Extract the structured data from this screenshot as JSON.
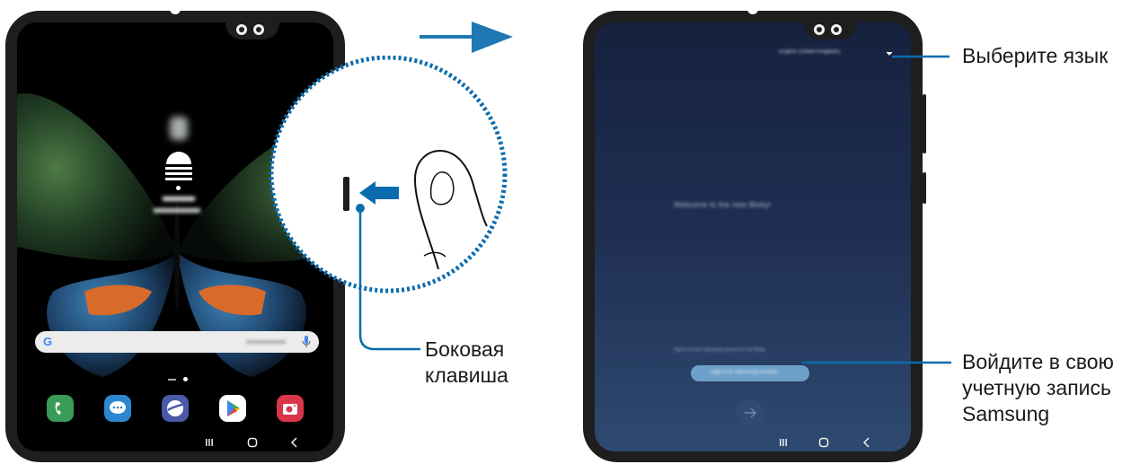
{
  "callouts": {
    "side_key_line1": "Боковая",
    "side_key_line2": "клавиша",
    "select_language": "Выберите язык",
    "sign_in_line1": "Войдите в свою",
    "sign_in_line2": "учетную запись",
    "sign_in_line3": "Samsung"
  },
  "left_device": {
    "search_bar_google_letter": "G",
    "nav_icons": [
      "recent-apps-icon",
      "home-icon",
      "back-icon"
    ],
    "dock_apps": [
      "phone-app-icon",
      "messages-app-icon",
      "internet-app-icon",
      "play-store-app-icon",
      "camera-app-icon"
    ]
  },
  "right_device": {
    "nav_icons": [
      "recent-apps-icon",
      "home-icon",
      "back-icon"
    ]
  },
  "colors": {
    "callout_blue": "#0a6cad",
    "device_frame": "#1e1e1e",
    "setup_bg_top": "#16213f",
    "setup_bg_bottom": "#2f4a71",
    "sign_in_pill": "#6ca0c8"
  }
}
